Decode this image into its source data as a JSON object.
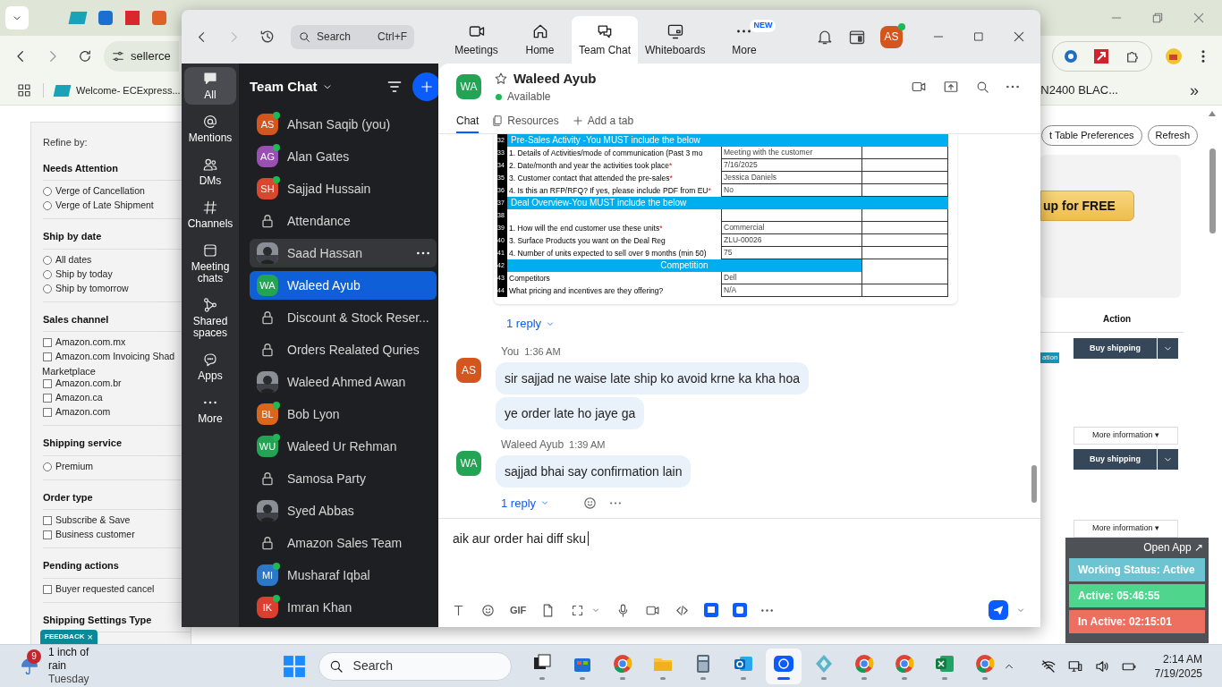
{
  "browser": {
    "address": "sellerce",
    "bookmarks": [
      "Welcome- ECExpress..."
    ],
    "bookmark_right": "N2400 BLAC...",
    "overflow": "»"
  },
  "amazon_filters": {
    "title": "Refine by:",
    "groups": [
      {
        "heading": "Needs Attention",
        "kind": "radio",
        "options": [
          {
            "label": "Verge of Cancellation",
            "checked": false
          },
          {
            "label": "Verge of Late Shipment",
            "checked": false
          }
        ]
      },
      {
        "heading": "Ship by date",
        "kind": "radio",
        "options": [
          {
            "label": "All dates",
            "checked": false
          },
          {
            "label": "Ship by today",
            "checked": false
          },
          {
            "label": "Ship by tomorrow",
            "checked": false
          }
        ]
      },
      {
        "heading": "Sales channel",
        "kind": "checkbox",
        "options": [
          {
            "label": "Amazon.com.mx",
            "checked": false
          },
          {
            "label": "Amazon.com Invoicing Shad",
            "continuation": "Marketplace",
            "checked": false
          },
          {
            "label": "Amazon.com.br",
            "checked": false
          },
          {
            "label": "Amazon.ca",
            "checked": false
          },
          {
            "label": "Amazon.com",
            "checked": false
          }
        ]
      },
      {
        "heading": "Shipping service",
        "kind": "radio",
        "options": [
          {
            "label": "Premium",
            "checked": false
          }
        ]
      },
      {
        "heading": "Order type",
        "kind": "checkbox",
        "options": [
          {
            "label": "Subscribe & Save",
            "checked": false
          },
          {
            "label": "Business customer",
            "checked": false
          }
        ]
      },
      {
        "heading": "Pending actions",
        "kind": "checkbox",
        "options": [
          {
            "label": "Buyer requested cancel",
            "checked": false
          }
        ]
      },
      {
        "heading": "Shipping Settings Type"
      }
    ]
  },
  "feedback_tab": {
    "label": "FEEDBACK",
    "close": "×"
  },
  "amazon_orders": {
    "toolbar": [
      "t Table Preferences",
      "Refresh"
    ],
    "promo": "up for FREE",
    "action_header": "Action",
    "tag": "ation",
    "rows": [
      {
        "kind": "buy",
        "label": "Buy shipping"
      },
      {
        "kind": "info",
        "label": "More information ▾"
      },
      {
        "kind": "buy",
        "label": "Buy shipping"
      },
      {
        "kind": "info",
        "label": "More information ▾"
      }
    ]
  },
  "zoom": {
    "search": {
      "placeholder": "Search",
      "shortcut": "Ctrl+F"
    },
    "nav": [
      {
        "label": "Meetings",
        "selected": false
      },
      {
        "label": "Home",
        "selected": false
      },
      {
        "label": "Team Chat",
        "selected": true
      },
      {
        "label": "Whiteboards",
        "selected": false
      },
      {
        "label": "More",
        "selected": false,
        "badge": "NEW"
      }
    ],
    "profile": {
      "initials": "AS",
      "online": true
    },
    "rail": [
      {
        "label": "All",
        "selected": true
      },
      {
        "label": "Mentions",
        "selected": false
      },
      {
        "label": "DMs",
        "selected": false
      },
      {
        "label": "Channels",
        "selected": false
      },
      {
        "label": "Meeting chats",
        "selected": false
      },
      {
        "label": "Shared spaces",
        "selected": false
      },
      {
        "label": "Apps",
        "selected": false
      },
      {
        "label": "More",
        "selected": false
      }
    ],
    "list": {
      "title": "Team Chat",
      "items": [
        {
          "kind": "person",
          "name": "Ahsan Saqib (you)",
          "initials": "AS",
          "color": "#d4561f",
          "online": true,
          "selected": false
        },
        {
          "kind": "person",
          "name": "Alan Gates",
          "initials": "AG",
          "color": "#9a4fb5",
          "online": true,
          "selected": false
        },
        {
          "kind": "person",
          "name": "Sajjad Hussain",
          "initials": "SH",
          "color": "#d9472f",
          "online": true,
          "selected": false
        },
        {
          "kind": "channel",
          "name": "Attendance",
          "selected": false
        },
        {
          "name": "Saad Hassan",
          "selected": false,
          "hovered": true
        },
        {
          "kind": "person",
          "name": "Waleed Ayub",
          "initials": "WA",
          "color": "#23a455",
          "online": false,
          "selected": true
        },
        {
          "kind": "channel",
          "name": "Discount & Stock Reser...",
          "selected": false
        },
        {
          "kind": "channel",
          "name": "Orders Realated Quries",
          "selected": false
        },
        {
          "name": "Waleed Ahmed Awan",
          "selected": false
        },
        {
          "kind": "person",
          "name": "Bob Lyon",
          "initials": "BL",
          "color": "#d9661c",
          "online": true,
          "selected": false
        },
        {
          "kind": "person",
          "name": "Waleed Ur Rehman",
          "initials": "WU",
          "color": "#23a455",
          "online": true,
          "selected": false
        },
        {
          "kind": "channel",
          "name": "Samosa Party",
          "selected": false
        },
        {
          "name": "Syed Abbas",
          "selected": false
        },
        {
          "kind": "channel",
          "name": "Amazon Sales Team",
          "selected": false
        },
        {
          "kind": "person",
          "name": "Musharaf Iqbal",
          "initials": "MI",
          "color": "#2b78c9",
          "online": true,
          "selected": false
        },
        {
          "kind": "person",
          "name": "Imran Khan",
          "initials": "IK",
          "color": "#d9402f",
          "online": true,
          "selected": false
        }
      ]
    },
    "conversation": {
      "name": "Waleed Ayub",
      "initials": "WA",
      "color": "#23a455",
      "presence": "Available",
      "tabs": [
        {
          "label": "Chat",
          "selected": true
        },
        {
          "label": "Resources",
          "selected": false
        },
        {
          "label": "Add a tab",
          "selected": false
        }
      ],
      "sheet": {
        "rows": [
          {
            "num": "32",
            "kind": "section",
            "label": "Pre-Sales Activity -You MUST include the below"
          },
          {
            "num": "33",
            "kind": "data",
            "label": "1. Details of Activities/mode of communication (Past 3 mo",
            "value": "Meeting with the customer"
          },
          {
            "num": "34",
            "kind": "data",
            "label": "2. Date/month and year the activities took place",
            "mark": "*",
            "value": "7/16/2025"
          },
          {
            "num": "35",
            "kind": "data",
            "label": "3. Customer contact that attended the pre-sales",
            "mark": "*",
            "value": "Jessica Daniels"
          },
          {
            "num": "36",
            "kind": "data",
            "label": "4. Is this an RFP/RFQ? If yes, please include PDF from EU",
            "mark": "*",
            "value": "No"
          },
          {
            "num": "37",
            "kind": "section",
            "label": "Deal Overview-You MUST include the below"
          },
          {
            "num": "38",
            "kind": "data"
          },
          {
            "num": "39",
            "kind": "data",
            "label": "1. How will the end customer use these units",
            "mark": "*",
            "value": "Commercial"
          },
          {
            "num": "40",
            "kind": "data",
            "label": "3. Surface Products you want on the Deal Reg",
            "value": "ZLU-00026"
          },
          {
            "num": "41",
            "kind": "data",
            "label": "4. Number of units expected to sell over 9 months (min 50)",
            "value": "75"
          },
          {
            "num": "42",
            "kind": "centered",
            "label": "Competition"
          },
          {
            "num": "43",
            "kind": "data",
            "label": "Competitors",
            "value": "Dell"
          },
          {
            "num": "44",
            "kind": "data",
            "label": "What pricing and incentives are they offering?",
            "value": "N/A"
          }
        ]
      },
      "sheet_reply": "1 reply",
      "groups": [
        {
          "sender": "You",
          "time": "1:36 AM",
          "initials": "AS",
          "color": "#d4561f",
          "messages": [
            "sir sajjad ne waise late ship ko avoid krne ka kha hoa",
            "ye order late ho jaye ga"
          ]
        },
        {
          "sender": "Waleed Ayub",
          "time": "1:39 AM",
          "initials": "WA",
          "color": "#23a455",
          "messages": [
            "sajjad bhai say confirmation lain"
          ],
          "reply": "1 reply"
        }
      ],
      "composer": {
        "value": "aik aur order hai diff sku",
        "format_label": "GIF"
      }
    }
  },
  "tracker": {
    "open_app": "Open App ↗",
    "rows": [
      {
        "label": "Working Status: Active",
        "color": "#6cc3d1"
      },
      {
        "label": "Active: 05:46:55",
        "color": "#4fd68c"
      },
      {
        "label": "In Active: 02:15:01",
        "color": "#ee6e5f"
      }
    ]
  },
  "taskbar": {
    "weather": {
      "badge": "9",
      "line1": "1 inch of rain",
      "line2": "Tuesday"
    },
    "search": {
      "placeholder": "Search"
    },
    "apps": [
      {
        "kind": "taskview",
        "active": false
      },
      {
        "kind": "store",
        "active": false
      },
      {
        "kind": "chrome",
        "active": false
      },
      {
        "kind": "folder",
        "active": false
      },
      {
        "kind": "calculator",
        "active": false
      },
      {
        "kind": "outlook",
        "active": false
      },
      {
        "kind": "zoom",
        "active": true
      },
      {
        "kind": "diamond",
        "active": false
      },
      {
        "kind": "chrome",
        "active": false
      },
      {
        "kind": "chrome",
        "active": false
      },
      {
        "kind": "excel",
        "active": false
      },
      {
        "kind": "chrome",
        "active": false
      }
    ],
    "time": "2:14 AM",
    "date": "7/19/2025"
  }
}
